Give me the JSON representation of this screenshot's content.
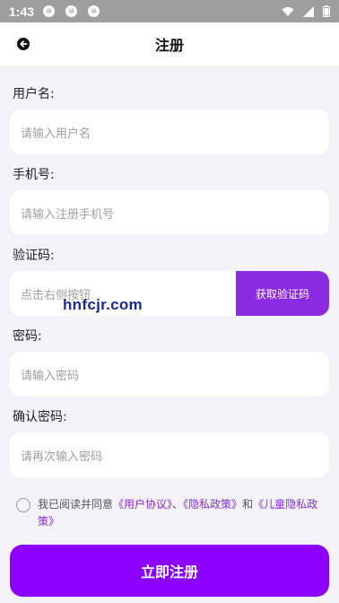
{
  "status_bar": {
    "time": "1:43",
    "notif_icons": [
      "⑩",
      "⑩",
      "⑩"
    ]
  },
  "nav": {
    "title": "注册"
  },
  "form": {
    "username": {
      "label": "用户名:",
      "placeholder": "请输入用户名"
    },
    "phone": {
      "label": "手机号:",
      "placeholder": "请输入注册手机号"
    },
    "code": {
      "label": "验证码:",
      "placeholder": "点击右侧按钮",
      "button": "获取验证码"
    },
    "password": {
      "label": "密码:",
      "placeholder": "请输入密码"
    },
    "confirm": {
      "label": "确认密码:",
      "placeholder": "请再次输入密码"
    }
  },
  "agreement": {
    "prefix": "我已阅读并同意",
    "user_agreement": "《用户协议》",
    "sep1": "、",
    "privacy_policy": "《隐私政策》",
    "sep2": "和",
    "child_privacy": "《儿童隐私政策》"
  },
  "submit_label": "立即注册",
  "watermark": "hnfcjr.com",
  "colors": {
    "accent": "#8b00ff",
    "code_button": "#8a2be2",
    "background": "#f3f2f8"
  }
}
